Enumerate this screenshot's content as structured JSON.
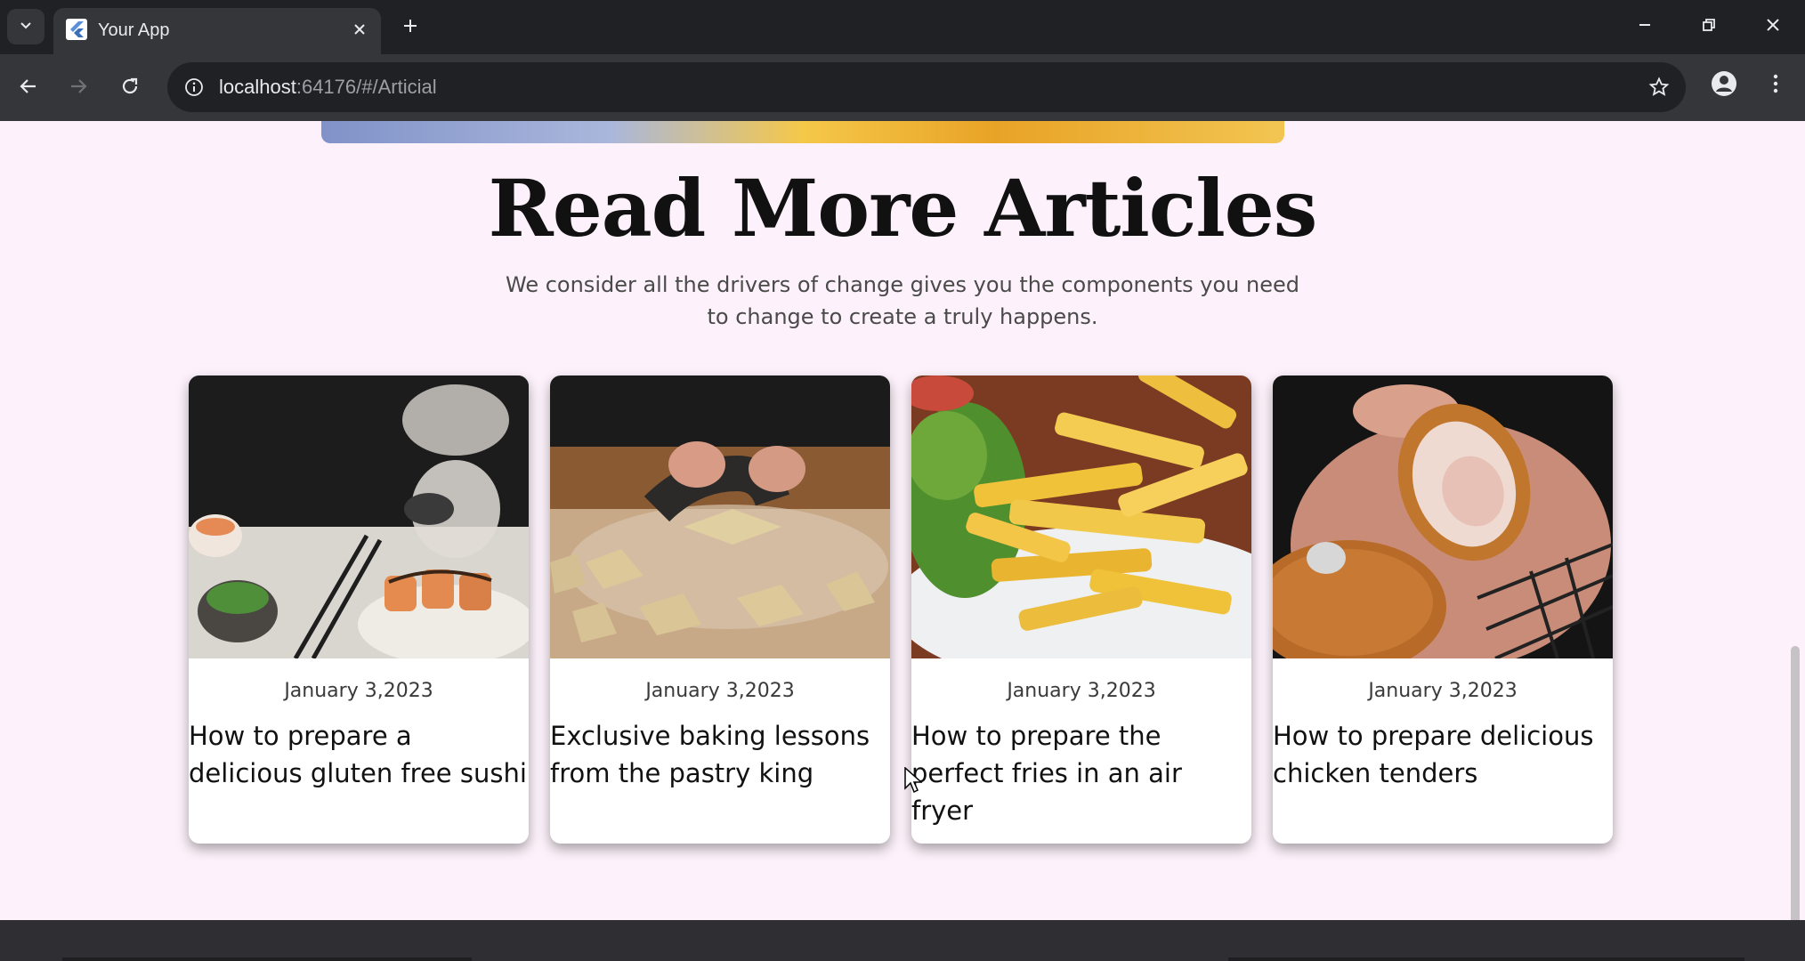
{
  "browser": {
    "tab_title": "Your App",
    "url_host": "localhost",
    "url_path": ":64176/#/Articial"
  },
  "section": {
    "title": "Read More Articles",
    "subtitle_line1": "We consider all the drivers of change gives you the components you need",
    "subtitle_line2": "to change to create a truly happens."
  },
  "articles": [
    {
      "date": "January 3,2023",
      "title": "How to prepare a delicious gluten free sushi",
      "image": "sushi-photo"
    },
    {
      "date": "January 3,2023",
      "title": "Exclusive baking lessons from the pastry king",
      "image": "pastry-photo"
    },
    {
      "date": "January 3,2023",
      "title": "How to prepare the perfect fries in an air fryer",
      "image": "fries-photo"
    },
    {
      "date": "January 3,2023",
      "title": "How to prepare delicious chicken tenders",
      "image": "chicken-tenders-photo"
    }
  ],
  "icons": {
    "tab_menu": "chevron-down-icon",
    "favicon": "flutter-icon",
    "tab_close": "close-icon",
    "new_tab": "plus-icon",
    "minimize": "minimize-icon",
    "restore": "restore-icon",
    "close_window": "close-icon",
    "back": "arrow-left-icon",
    "forward": "arrow-right-icon",
    "reload": "reload-icon",
    "site_info": "info-icon",
    "bookmark": "star-icon",
    "profile": "person-icon",
    "menu": "more-vertical-icon"
  },
  "colors": {
    "page_bg": "#fdf2fb",
    "chrome_dark": "#202124",
    "chrome_mid": "#35363a",
    "title_text": "#111111"
  }
}
